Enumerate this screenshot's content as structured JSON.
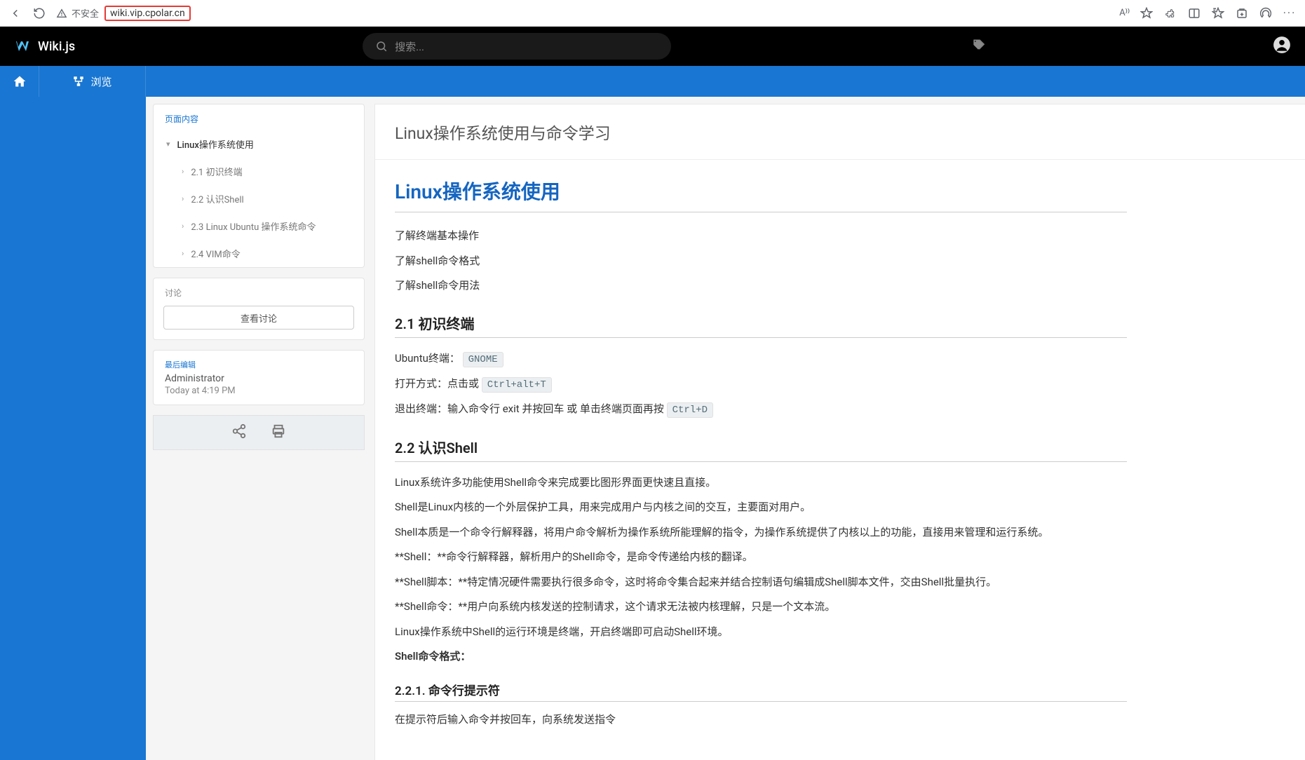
{
  "browser": {
    "insecure_label": "不安全",
    "url": "wiki.vip.cpolar.cn",
    "read_aloud_label": "A⁾⁾"
  },
  "header": {
    "site_name": "Wiki.js",
    "search_placeholder": "搜索..."
  },
  "toolbar": {
    "browse_label": "浏览"
  },
  "toc": {
    "title": "页面内容",
    "items": [
      {
        "label": "Linux操作系统使用",
        "level": 1
      },
      {
        "label": "2.1 初识终端",
        "level": 2
      },
      {
        "label": "2.2 认识Shell",
        "level": 2
      },
      {
        "label": "2.3 Linux Ubuntu 操作系统命令",
        "level": 2
      },
      {
        "label": "2.4 VIM命令",
        "level": 2
      }
    ]
  },
  "discuss": {
    "title": "讨论",
    "button": "查看讨论"
  },
  "last_edit": {
    "label": "最后编辑",
    "author": "Administrator",
    "time": "Today at 4:19 PM"
  },
  "page": {
    "title": "Linux操作系统使用与命令学习"
  },
  "article": {
    "h1": "Linux操作系统使用",
    "intro1": "了解终端基本操作",
    "intro2": "了解shell命令格式",
    "intro3": "了解shell命令用法",
    "s21_title": "2.1 初识终端",
    "s21_l1_pre": "Ubuntu终端：",
    "s21_l1_code": "GNOME",
    "s21_l2_pre": "打开方式：点击或 ",
    "s21_l2_code": "Ctrl+alt+T",
    "s21_l3_pre": "退出终端：输入命令行 exit 并按回车 或 单击终端页面再按 ",
    "s21_l3_code": "Ctrl+D",
    "s22_title": "2.2 认识Shell",
    "s22_p1": "Linux系统许多功能使用Shell命令来完成要比图形界面更快速且直接。",
    "s22_p2": "Shell是Linux内核的一个外层保护工具，用来完成用户与内核之间的交互，主要面对用户。",
    "s22_p3": "Shell本质是一个命令行解释器，将用户命令解析为操作系统所能理解的指令，为操作系统提供了内核以上的功能，直接用来管理和运行系统。",
    "s22_p4": "**Shell：**命令行解释器，解析用户的Shell命令，是命令传递给内核的翻译。",
    "s22_p5": "**Shell脚本：**特定情况硬件需要执行很多命令，这时将命令集合起来并结合控制语句编辑成Shell脚本文件，交由Shell批量执行。",
    "s22_p6": "**Shell命令：**用户向系统内核发送的控制请求，这个请求无法被内核理解，只是一个文本流。",
    "s22_p7": "Linux操作系统中Shell的运行环境是终端，开启终端即可启动Shell环境。",
    "s22_p8": "Shell命令格式：",
    "s221_title": "2.2.1. 命令行提示符",
    "s221_p1": "在提示符后输入命令并按回车，向系统发送指令"
  }
}
